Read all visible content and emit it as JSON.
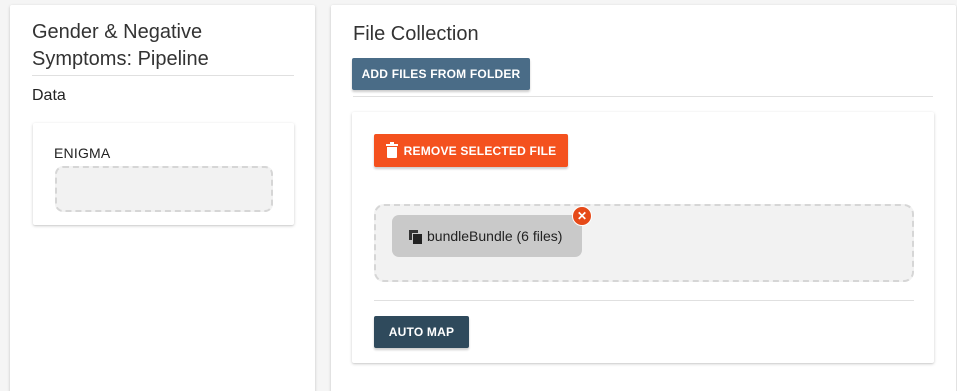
{
  "left_panel": {
    "title": "Gender & Negative Symptoms: Pipeline",
    "data_heading": "Data",
    "sources": [
      {
        "name": "ENIGMA"
      }
    ]
  },
  "right_panel": {
    "title": "File Collection",
    "add_files_label": "ADD FILES FROM FOLDER",
    "remove_selected_label": "REMOVE SELECTED FILE",
    "files": [
      {
        "label": "bundleBundle (6 files)",
        "remove_icon": "close-circle-icon",
        "icon": "file-copy-icon"
      }
    ],
    "auto_map_label": "AUTO MAP"
  },
  "colors": {
    "primary": "#4a6c87",
    "danger": "#f4511e",
    "dark": "#2f4a5c"
  }
}
